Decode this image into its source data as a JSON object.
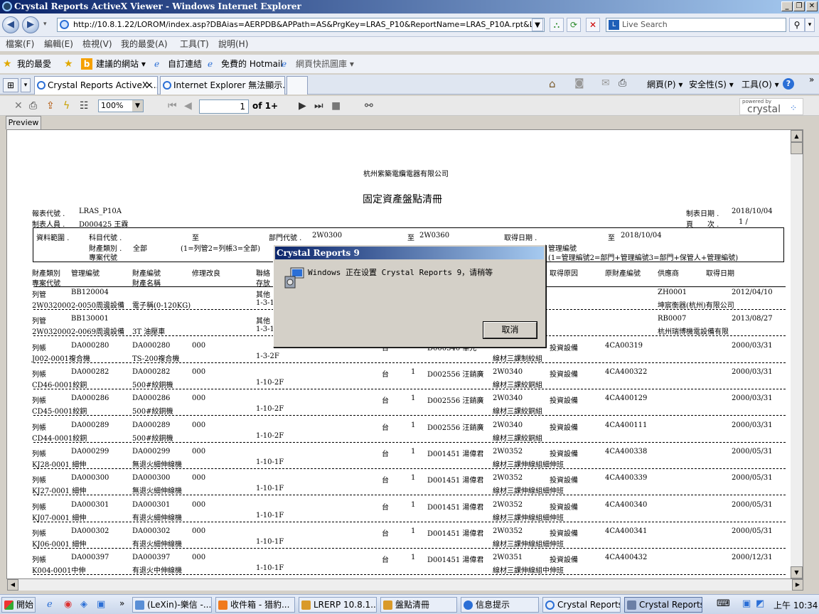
{
  "window": {
    "title": "Crystal Reports ActiveX Viewer - Windows Internet Explorer"
  },
  "address": {
    "url": "http://10.8.1.22/LOROM/index.asp?DBAias=AERPDB&APPath=AS&PrgKey=LRAS_P10&ReportName=LRAS_P10A.rpt&LanguageTyp",
    "search_placeholder": "Live Search"
  },
  "menu": [
    "檔案(F)",
    "編輯(E)",
    "檢視(V)",
    "我的最愛(A)",
    "工具(T)",
    "說明(H)"
  ],
  "favorites": {
    "label": "我的最愛",
    "items": [
      "建議的網站 ▾",
      "自訂連結",
      "免費的 Hotmail",
      "網頁快訊圖庫 ▾"
    ]
  },
  "tabs": [
    "Crystal Reports ActiveX ...",
    "Internet Explorer 無法顯示..."
  ],
  "ie_commands": [
    "網頁(P) ▾",
    "安全性(S) ▾",
    "工具(O) ▾"
  ],
  "viewer": {
    "zoom": "100%",
    "page": "1",
    "page_of": "of 1+",
    "preview_tab": "Preview",
    "powered_by": "powered by",
    "brand": "crystal"
  },
  "report": {
    "company": "杭州紫築電纜電器有限公司",
    "title": "固定資產盤點清冊",
    "left_meta": [
      [
        "報表代號 .",
        "LRAS_P10A"
      ],
      [
        "制表人員 .",
        "D000425 王霖"
      ]
    ],
    "right_meta": [
      [
        "制表日期 .",
        "2018/10/04"
      ],
      [
        "頁　　次 .",
        "1 /"
      ]
    ],
    "criteria": {
      "range_label": "資料範圍 .",
      "item_code": "科目代號 .",
      "to1": "至",
      "dept_code": "部門代號 .",
      "dept_from": "2W0300",
      "to2": "至",
      "dept_to": "2W0360",
      "acq_date": "取得日期 .",
      "to3": "至",
      "date_to": "2018/10/04",
      "asset_class": "財產類別 .",
      "class_value": "全部",
      "class_note": "(1=列管2=列帳3=全部)",
      "proj_code": "專案代號",
      "mgmt_no": "管理編號",
      "mgmt_note": "(1=管理編號2=部門+管理編號3=部門+保管人+管理編號)"
    },
    "headers": {
      "l1": [
        "財產類別",
        "管理編號",
        "財產編號",
        "修理改良",
        "聯絡",
        "取得原因",
        "原財產編號",
        "供應商",
        "取得日期"
      ],
      "l2": [
        "專案代號",
        "財產名稱",
        "存放"
      ]
    },
    "rows": [
      {
        "cat": "列管",
        "mgmt": "BB120004",
        "asset": "",
        "fix": "",
        "loc1": "其他",
        "unit": "",
        "qty": "",
        "keeper": "",
        "dept": "",
        "reason": "",
        "orig": "",
        "supplier": "ZH0001",
        "date": "2012/04/10",
        "proj": "2W0320002-0050周邊設備",
        "name": "電子稱(0-120KG)",
        "loc2": "1-3-1F",
        "dept2": "",
        "supplier2": "坤宸衡器(杭州)有限公司"
      },
      {
        "cat": "列管",
        "mgmt": "BB130001",
        "asset": "",
        "fix": "",
        "loc1": "其他",
        "unit": "",
        "qty": "",
        "keeper": "",
        "dept": "",
        "reason": "",
        "orig": "",
        "supplier": "RB0007",
        "date": "2013/08/27",
        "proj": "2W0320002-0069周邊設備",
        "name": "3T 油壓車",
        "loc2": "1-3-1F",
        "dept2": "",
        "supplier2": "杭州瑞博機電設備有限"
      },
      {
        "cat": "列帳",
        "mgmt": "DA000280",
        "asset": "DA000280",
        "fix": "000",
        "loc1": "",
        "unit": "台",
        "qty": "1",
        "keeper": "D000340 華光",
        "dept": "2W0320",
        "reason": "投資設備",
        "orig": "4CA00319",
        "supplier": "",
        "date": "2000/03/31",
        "proj": "J002-0001複合機",
        "name": "TS-200複合機",
        "loc2": "1-3-2F",
        "dept2": "線材三課制絞組",
        "supplier2": ""
      },
      {
        "cat": "列帳",
        "mgmt": "DA000282",
        "asset": "DA000282",
        "fix": "000",
        "loc1": "",
        "unit": "台",
        "qty": "1",
        "keeper": "D002556 汪銷廣",
        "dept": "2W0340",
        "reason": "投資設備",
        "orig": "4CA400322",
        "supplier": "",
        "date": "2000/03/31",
        "proj": "CD46-0001絞銅",
        "name": "500#絞銅機",
        "loc2": "1-10-2F",
        "dept2": "線材三課絞銅組",
        "supplier2": ""
      },
      {
        "cat": "列帳",
        "mgmt": "DA000286",
        "asset": "DA000286",
        "fix": "000",
        "loc1": "",
        "unit": "台",
        "qty": "1",
        "keeper": "D002556 汪銷廣",
        "dept": "2W0340",
        "reason": "投資設備",
        "orig": "4CA400129",
        "supplier": "",
        "date": "2000/03/31",
        "proj": "CD45-0001絞銅",
        "name": "500#絞銅機",
        "loc2": "1-10-2F",
        "dept2": "線材三課絞銅組",
        "supplier2": ""
      },
      {
        "cat": "列帳",
        "mgmt": "DA000289",
        "asset": "DA000289",
        "fix": "000",
        "loc1": "",
        "unit": "台",
        "qty": "1",
        "keeper": "D002556 汪銷廣",
        "dept": "2W0340",
        "reason": "投資設備",
        "orig": "4CA400111",
        "supplier": "",
        "date": "2000/03/31",
        "proj": "CD44-0001絞銅",
        "name": "500#絞銅機",
        "loc2": "1-10-2F",
        "dept2": "線材三課絞銅組",
        "supplier2": ""
      },
      {
        "cat": "列帳",
        "mgmt": "DA000299",
        "asset": "DA000299",
        "fix": "000",
        "loc1": "",
        "unit": "台",
        "qty": "1",
        "keeper": "D001451 湯偉君",
        "dept": "2W0352",
        "reason": "投資設備",
        "orig": "4CA400338",
        "supplier": "",
        "date": "2000/05/31",
        "proj": "KJ28-0001 細伸",
        "name": "無退火細伸線機",
        "loc2": "1-10-1F",
        "dept2": "線材三課伸線組細伸班",
        "supplier2": ""
      },
      {
        "cat": "列帳",
        "mgmt": "DA000300",
        "asset": "DA000300",
        "fix": "000",
        "loc1": "",
        "unit": "台",
        "qty": "1",
        "keeper": "D001451 湯偉君",
        "dept": "2W0352",
        "reason": "投資設備",
        "orig": "4CA400339",
        "supplier": "",
        "date": "2000/05/31",
        "proj": "KJ27-0001 細伸",
        "name": "無退火細伸線機",
        "loc2": "1-10-1F",
        "dept2": "線材三課伸線組細伸班",
        "supplier2": ""
      },
      {
        "cat": "列帳",
        "mgmt": "DA000301",
        "asset": "DA000301",
        "fix": "000",
        "loc1": "",
        "unit": "台",
        "qty": "1",
        "keeper": "D001451 湯偉君",
        "dept": "2W0352",
        "reason": "投資設備",
        "orig": "4CA400340",
        "supplier": "",
        "date": "2000/05/31",
        "proj": "KJ07-0001 細伸",
        "name": "有退火細伸線機",
        "loc2": "1-10-1F",
        "dept2": "線材三課伸線組細伸班",
        "supplier2": ""
      },
      {
        "cat": "列帳",
        "mgmt": "DA000302",
        "asset": "DA000302",
        "fix": "000",
        "loc1": "",
        "unit": "台",
        "qty": "1",
        "keeper": "D001451 湯偉君",
        "dept": "2W0352",
        "reason": "投資設備",
        "orig": "4CA400341",
        "supplier": "",
        "date": "2000/05/31",
        "proj": "KJ06-0001 細伸",
        "name": "有退火細伸線機",
        "loc2": "1-10-1F",
        "dept2": "線材三課伸線組細伸班",
        "supplier2": ""
      },
      {
        "cat": "列帳",
        "mgmt": "DA000397",
        "asset": "DA000397",
        "fix": "000",
        "loc1": "",
        "unit": "台",
        "qty": "1",
        "keeper": "D001451 湯偉君",
        "dept": "2W0351",
        "reason": "投資設備",
        "orig": "4CA400432",
        "supplier": "",
        "date": "2000/12/31",
        "proj": "K004-0001中伸",
        "name": "有退火中伸線機",
        "loc2": "1-10-1F",
        "dept2": "線材三課伸線組中伸班",
        "supplier2": ""
      }
    ]
  },
  "dialog": {
    "title": "Crystal Reports 9",
    "message": "Windows 正在设置 Crystal Reports 9，请稍等",
    "cancel": "取消"
  },
  "taskbar": {
    "start": "開始",
    "tasks": [
      "(LeXin)-樂信 -...",
      "收件箱 - 猎豹...",
      "LRERP 10.8.1....",
      "盤點清冊",
      "信息提示",
      "Crystal Reports ...",
      "Crystal Reports 9"
    ],
    "clock": "上午 10:34"
  }
}
